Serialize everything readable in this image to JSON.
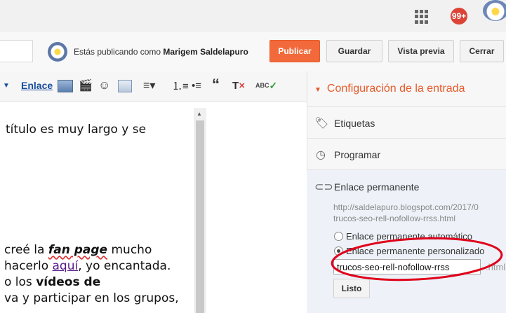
{
  "topbar": {
    "notification_count": "99+"
  },
  "actionbar": {
    "publishing_prefix": "Estás publicando como ",
    "author_name": "Marigem Saldelapuro",
    "publish_label": "Publicar",
    "save_label": "Guardar",
    "preview_label": "Vista previa",
    "close_label": "Cerrar"
  },
  "toolbar": {
    "link_label": "Enlace",
    "spellcheck_text": "ABC"
  },
  "editor": {
    "line1": "título es muy largo y se",
    "line2_prefix": "creé la ",
    "line2_bold": "fan page",
    "line2_suffix": " mucho",
    "line3_prefix": "hacerlo ",
    "line3_link": "aquí",
    "line3_suffix": ", yo encantada.",
    "line4_prefix": "o los ",
    "line4_bold": "vídeos de",
    "line5": "va y participar en los grupos,"
  },
  "settings": {
    "header": "Configuración de la entrada",
    "labels_item": "Etiquetas",
    "schedule_item": "Programar",
    "permalink_title": "Enlace permanente",
    "permalink_url_line1": "http://saldelapuro.blogspot.com/2017/0",
    "permalink_url_line2": "trucos-seo-rell-nofollow-rrss.html",
    "radio_auto_label": "Enlace permanente automático",
    "radio_custom_label": "Enlace permanente personalizado",
    "custom_value": "trucos-seo-rell-nofollow-rrss",
    "html_suffix": ".html",
    "done_label": "Listo"
  },
  "colors": {
    "accent": "#f26a3c",
    "header_orange": "#e65a2a",
    "annotation_red": "#e0001b"
  }
}
